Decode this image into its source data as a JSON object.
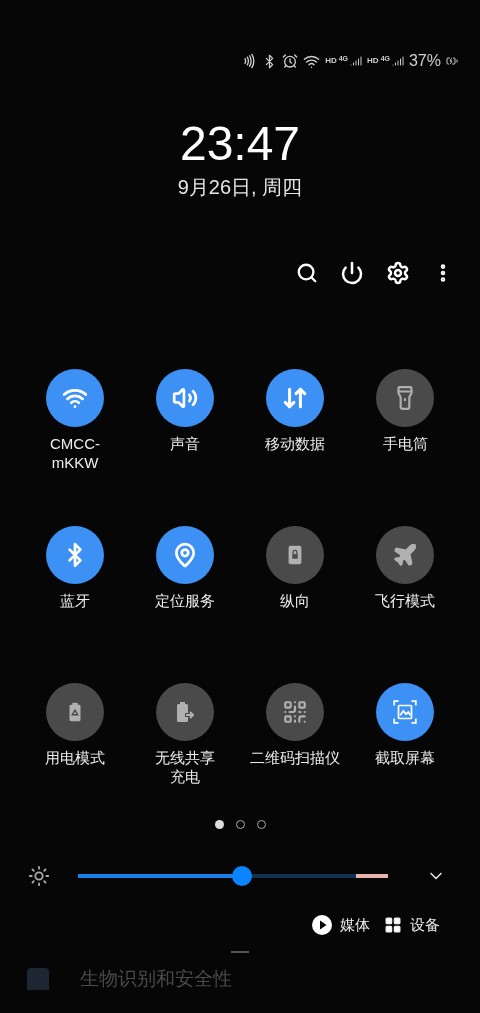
{
  "status_bar": {
    "networks": [
      {
        "hd": "HD",
        "net": "4G"
      },
      {
        "hd": "HD",
        "net": "4G"
      }
    ],
    "battery": "37%"
  },
  "clock": {
    "time": "23:47",
    "date": "9月26日, 周四"
  },
  "tiles": [
    {
      "kind": "wifi",
      "label": [
        "CMCC-",
        "mKKW"
      ],
      "on": true
    },
    {
      "kind": "sound",
      "label": "声音",
      "on": true
    },
    {
      "kind": "data",
      "label": "移动数据",
      "on": true
    },
    {
      "kind": "flashlight",
      "label": "手电筒",
      "on": false
    },
    {
      "kind": "bluetooth",
      "label": "蓝牙",
      "on": true
    },
    {
      "kind": "location",
      "label": "定位服务",
      "on": true
    },
    {
      "kind": "rotation",
      "label": "纵向",
      "on": false
    },
    {
      "kind": "airplane",
      "label": "飞行模式",
      "on": false
    },
    {
      "kind": "power-mode",
      "label": "用电模式",
      "on": false
    },
    {
      "kind": "wireless-share",
      "label": [
        "无线共享",
        "充电"
      ],
      "on": false
    },
    {
      "kind": "qr",
      "label": "二维码扫描仪",
      "on": false
    },
    {
      "kind": "screenshot",
      "label": "截取屏幕",
      "on": true
    }
  ],
  "pages": [
    {
      "selected": true
    },
    {
      "selected": false
    },
    {
      "selected": false
    }
  ],
  "brightness": {
    "level": 0.53
  },
  "media": {
    "media_label": "媒体",
    "devices_label": "设备"
  },
  "background_text": "生物识别和安全性"
}
